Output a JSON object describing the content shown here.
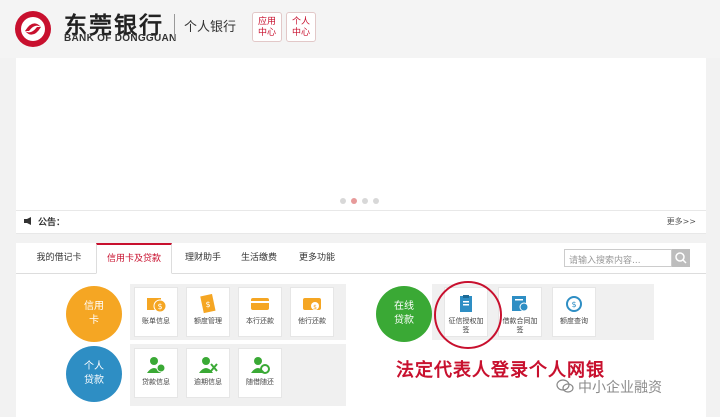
{
  "header": {
    "bank_name_cn": "东莞银行",
    "bank_name_en": "BANK OF DONGGUAN",
    "section": "个人银行",
    "buttons": [
      {
        "line1": "应用",
        "line2": "中心"
      },
      {
        "line1": "个人",
        "line2": "中心"
      }
    ]
  },
  "notice": {
    "label": "公告：",
    "more": "更多>>"
  },
  "tabs": [
    {
      "label": "我的借记卡",
      "active": false
    },
    {
      "label": "信用卡及贷款",
      "active": true
    },
    {
      "label": "理财助手",
      "active": false
    },
    {
      "label": "生活缴费",
      "active": false
    },
    {
      "label": "更多功能",
      "active": false
    }
  ],
  "search": {
    "placeholder": "请输入搜索内容..."
  },
  "credit": {
    "circle_line1": "信用",
    "circle_line2": "卡",
    "tiles": [
      "账单信息",
      "额度管理",
      "本行还款",
      "他行还款"
    ]
  },
  "loan": {
    "circle_line1": "个人",
    "circle_line2": "贷款",
    "tiles": [
      "贷款信息",
      "逾期信息",
      "随借随还"
    ]
  },
  "online_loan": {
    "circle_line1": "在线",
    "circle_line2": "贷款",
    "tiles": [
      {
        "line1": "征信授权加",
        "line2": "签"
      },
      {
        "line1": "借款合同加",
        "line2": "签"
      },
      {
        "line1": "额度查询",
        "line2": ""
      }
    ]
  },
  "slogan": "法定代表人登录个人网银",
  "watermark": "中小企业融资",
  "colors": {
    "brand_red": "#c8102e",
    "orange": "#f5a623",
    "green": "#3aa935",
    "blue": "#2e8ec4"
  }
}
